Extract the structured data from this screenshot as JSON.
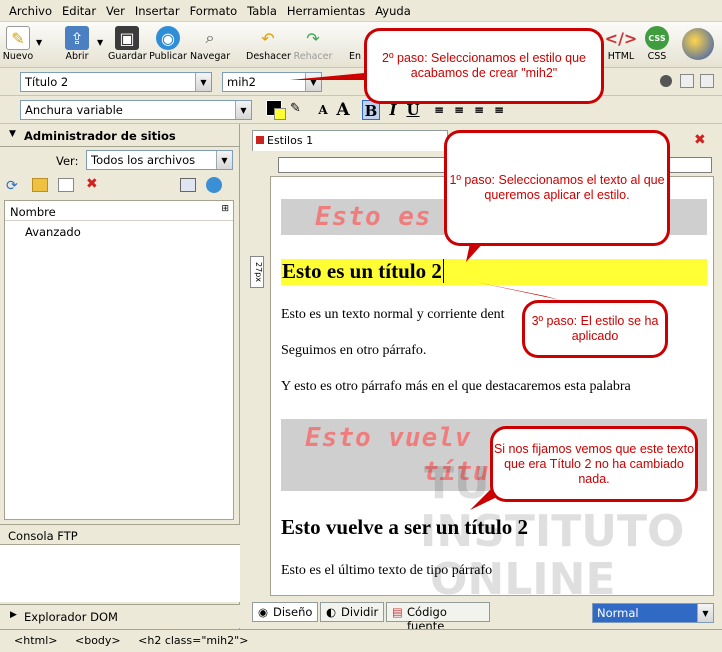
{
  "menu": [
    "Archivo",
    "Editar",
    "Ver",
    "Insertar",
    "Formato",
    "Tabla",
    "Herramientas",
    "Ayuda"
  ],
  "toolbar": {
    "new_label": "Nuevo",
    "open_label": "Abrir",
    "save_label": "Guardar",
    "publish_label": "Publicar",
    "browse_label": "Navegar",
    "undo_label": "Deshacer",
    "redo_label": "Rehacer",
    "partial_label": "En",
    "html_label": "HTML",
    "css_label": "CSS"
  },
  "format": {
    "paragraph_style": "Título 2",
    "class_style": "mih2",
    "width_mode": "Anchura variable"
  },
  "left_panel": {
    "site_manager_title": "Administrador de sitios",
    "view_label": "Ver:",
    "view_value": "Todos los archivos",
    "column_name": "Nombre",
    "items": [
      "Avanzado"
    ],
    "ftp_title": "Consola FTP",
    "dom_title": "Explorador DOM"
  },
  "editor": {
    "tab_label": "Estilos 1",
    "ruler_vertical": "27px",
    "doc": {
      "mih2_first": "Esto es",
      "title2": "Esto es un título 2",
      "para1": "Esto es un texto normal y corriente dent",
      "para2": "Seguimos en otro párrafo.",
      "para3": "Y esto es otro párrafo más en el que destacaremos esta palabra",
      "mih2_second_line1": "Esto vuelv",
      "mih2_second_line2": "títu",
      "title2_again": "Esto vuelve a ser un título 2",
      "last": "Esto es el último texto de tipo párrafo"
    },
    "watermark": [
      "TU",
      "INSTITUTO",
      "ONLINE"
    ],
    "view_tabs": [
      "Diseño",
      "Dividir",
      "Código fuente"
    ],
    "view_mode": "Normal"
  },
  "statusbar": [
    "<html>",
    "<body>",
    "<h2 class=\"mih2\">"
  ],
  "callouts": {
    "step2": "2º paso: Seleccionamos el estilo que acabamos de crear \"mih2\"",
    "step1": "1º paso: Seleccionamos el texto al que queremos aplicar el estilo.",
    "step3": "3º paso: El estilo se ha aplicado",
    "note": "Si nos fijamos vemos que este texto que era Título 2 no ha cambiado nada."
  },
  "colors": {
    "callout_red": "#cc0000",
    "highlight_yellow": "#ffff33",
    "mih2_text": "#f07d7d",
    "mih2_bg": "#cfcfcf",
    "view_select_blue": "#316ac5"
  }
}
